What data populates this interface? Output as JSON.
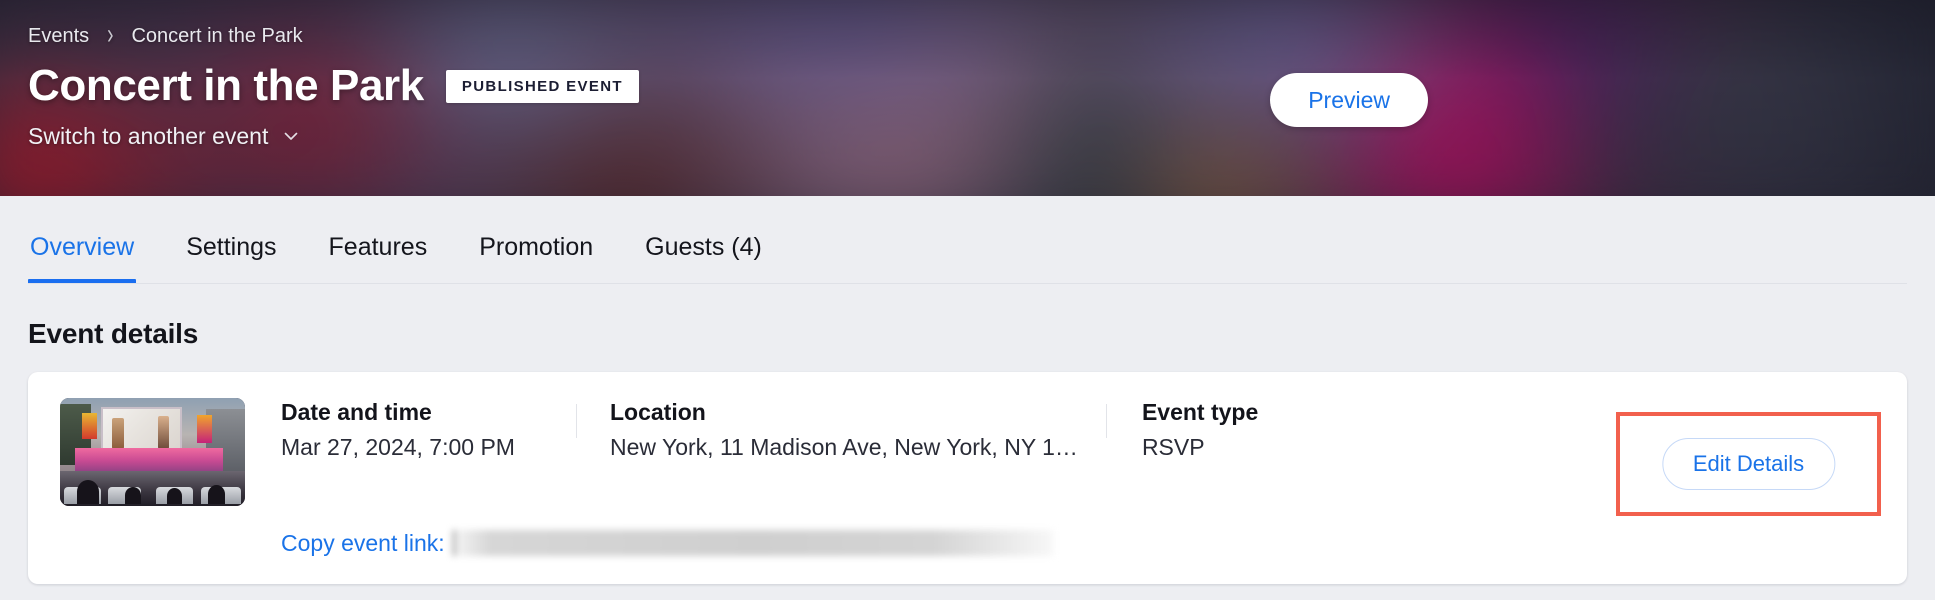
{
  "header": {
    "breadcrumb": [
      {
        "label": "Events"
      },
      {
        "label": "Concert in the Park"
      }
    ],
    "breadcrumb_separator": "›",
    "title": "Concert in the Park",
    "status_badge": "PUBLISHED EVENT",
    "switch_event_label": "Switch to another event",
    "preview_button": "Preview",
    "accent_color": "#1a73e8",
    "background_description": "blurred outdoor concert photo"
  },
  "tabs": [
    {
      "label": "Overview",
      "active": true
    },
    {
      "label": "Settings",
      "active": false
    },
    {
      "label": "Features",
      "active": false
    },
    {
      "label": "Promotion",
      "active": false
    },
    {
      "label": "Guests (4)",
      "active": false
    }
  ],
  "main": {
    "section_title": "Event details",
    "thumbnail_alt": "Outdoor concert stage with large screen",
    "fields": [
      {
        "label": "Date and time",
        "value": "Mar 27, 2024, 7:00 PM"
      },
      {
        "label": "Location",
        "value": "New York, 11 Madison Ave, New York, NY 1…"
      },
      {
        "label": "Event type",
        "value": "RSVP"
      }
    ],
    "copy_link_label": "Copy event link:",
    "copy_link_value": "",
    "edit_details_button": "Edit Details",
    "highlight_color": "#f2604d"
  }
}
